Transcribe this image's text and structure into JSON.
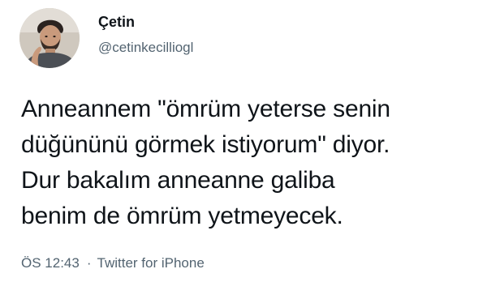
{
  "tweet": {
    "author": {
      "display_name": "Çetin",
      "handle": "@cetinkecilliogl",
      "avatar_icon": "user-avatar-photo"
    },
    "text_lines": [
      "Anneannem \"ömrüm yeterse senin",
      "düğününü görmek istiyorum\" diyor.",
      "Dur bakalım anneanne galiba",
      "benim de ömrüm yetmeyecek."
    ],
    "timestamp": "ÖS 12:43",
    "separator": "·",
    "source": "Twitter for iPhone"
  },
  "colors": {
    "text": "#0f1419",
    "secondary": "#536471",
    "background": "#ffffff"
  }
}
